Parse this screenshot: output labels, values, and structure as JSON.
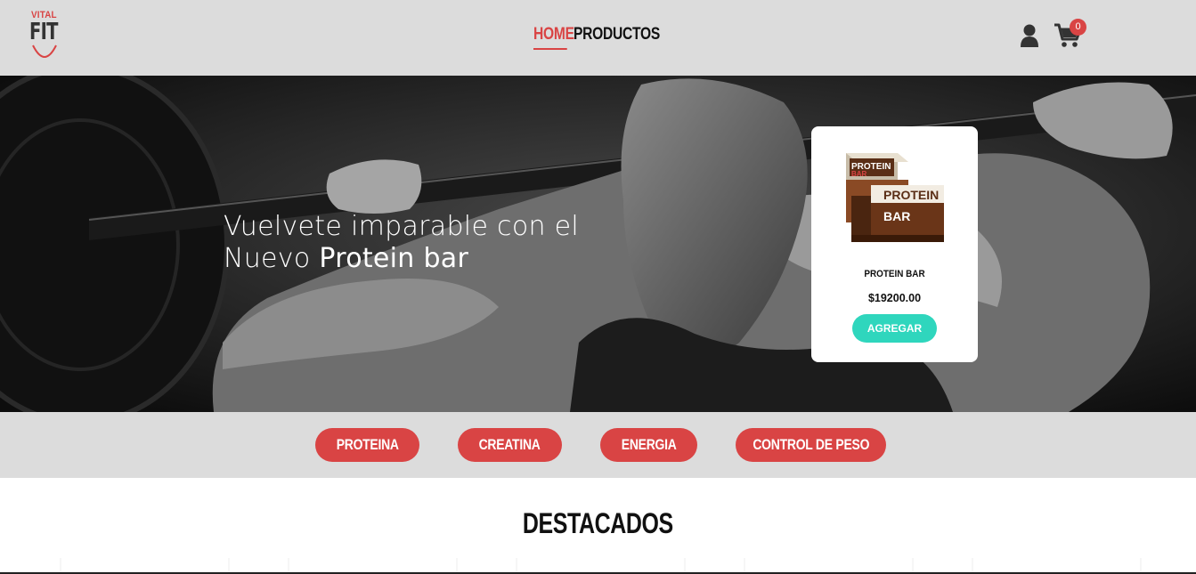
{
  "header": {
    "logo": {
      "top_text": "VITAL",
      "main_text": "FIT"
    },
    "nav": [
      {
        "label": "HOME",
        "active": true
      },
      {
        "label": "PRODUCTOS",
        "active": false
      }
    ],
    "cart_count": "0",
    "icons": [
      "user-icon",
      "cart-icon"
    ]
  },
  "hero": {
    "line1": "Vuelvete imparable con el",
    "line2_prefix": "Nuevo ",
    "line2_bold": "Protein bar",
    "card": {
      "name": "PROTEIN BAR",
      "price": "$19200.00",
      "button": "AGREGAR"
    }
  },
  "categories": [
    {
      "label": "PROTEINA"
    },
    {
      "label": "CREATINA"
    },
    {
      "label": "ENERGIA"
    },
    {
      "label": "CONTROL DE PESO"
    }
  ],
  "featured": {
    "title": "DESTACADOS"
  },
  "colors": {
    "accent_red": "#d94444",
    "accent_teal": "#2fd6bd",
    "header_bg": "#dcdcdc"
  }
}
